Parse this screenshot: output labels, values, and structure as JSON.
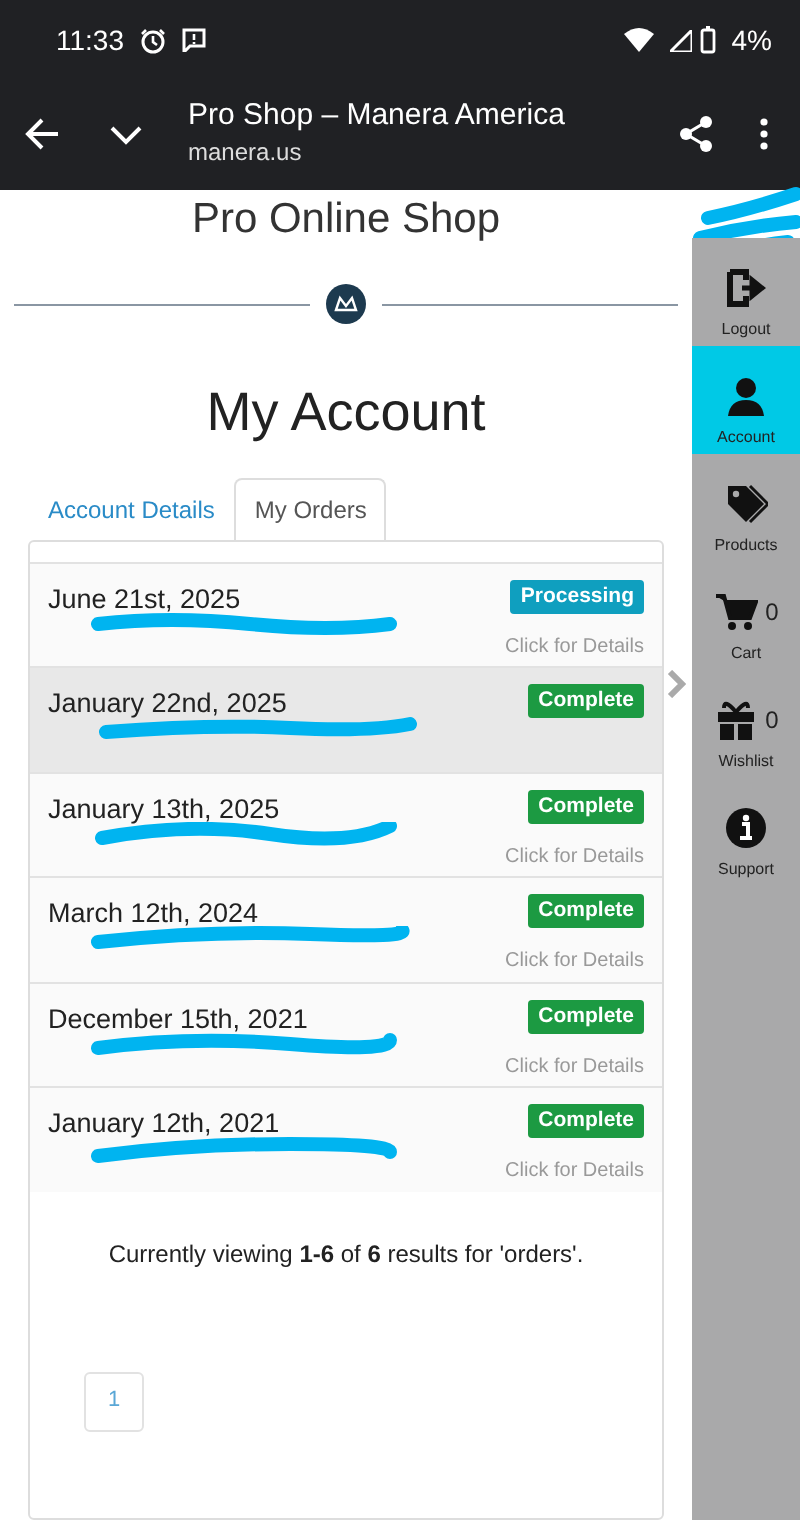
{
  "status_bar": {
    "time": "11:33",
    "battery": "4%"
  },
  "browser": {
    "title": "Pro Shop – Manera America",
    "url": "manera.us"
  },
  "site": {
    "heading": "Pro Online Shop",
    "top_redacted": true
  },
  "page_title": "My Account",
  "tabs": [
    {
      "label": "Account Details",
      "selected": false
    },
    {
      "label": "My Orders",
      "selected": true
    }
  ],
  "orders": [
    {
      "date": "June 21st, 2025",
      "status": "Processing",
      "kind": "processing",
      "details": "Click for Details",
      "highlighted": false,
      "redacted": true
    },
    {
      "date": "January 22nd, 2025",
      "status": "Complete",
      "kind": "complete",
      "highlighted": true,
      "redacted": true
    },
    {
      "date": "January 13th, 2025",
      "status": "Complete",
      "kind": "complete",
      "details": "Click for Details",
      "highlighted": false,
      "redacted": true
    },
    {
      "date": "March 12th, 2024",
      "status": "Complete",
      "kind": "complete",
      "details": "Click for Details",
      "highlighted": false,
      "redacted": true
    },
    {
      "date": "December 15th, 2021",
      "status": "Complete",
      "kind": "complete",
      "details": "Click for Details",
      "highlighted": false,
      "redacted": true
    },
    {
      "date": "January 12th, 2021",
      "status": "Complete",
      "kind": "complete",
      "details": "Click for Details",
      "highlighted": false,
      "redacted": true
    }
  ],
  "results_text": "Currently viewing **1-6** of **6** results for 'orders'.",
  "pagination": [
    {
      "label": "1"
    }
  ],
  "sidebar": [
    {
      "label": "Logout",
      "kind": "logout",
      "selected": false
    },
    {
      "label": "Account",
      "kind": "account",
      "selected": true
    },
    {
      "label": "Products",
      "kind": "products",
      "selected": false
    },
    {
      "label": "Cart",
      "kind": "cart",
      "count": "0",
      "selected": false
    },
    {
      "label": "Wishlist",
      "kind": "wishlist",
      "count": "0",
      "selected": false
    },
    {
      "label": "Support",
      "kind": "support",
      "selected": false
    }
  ]
}
